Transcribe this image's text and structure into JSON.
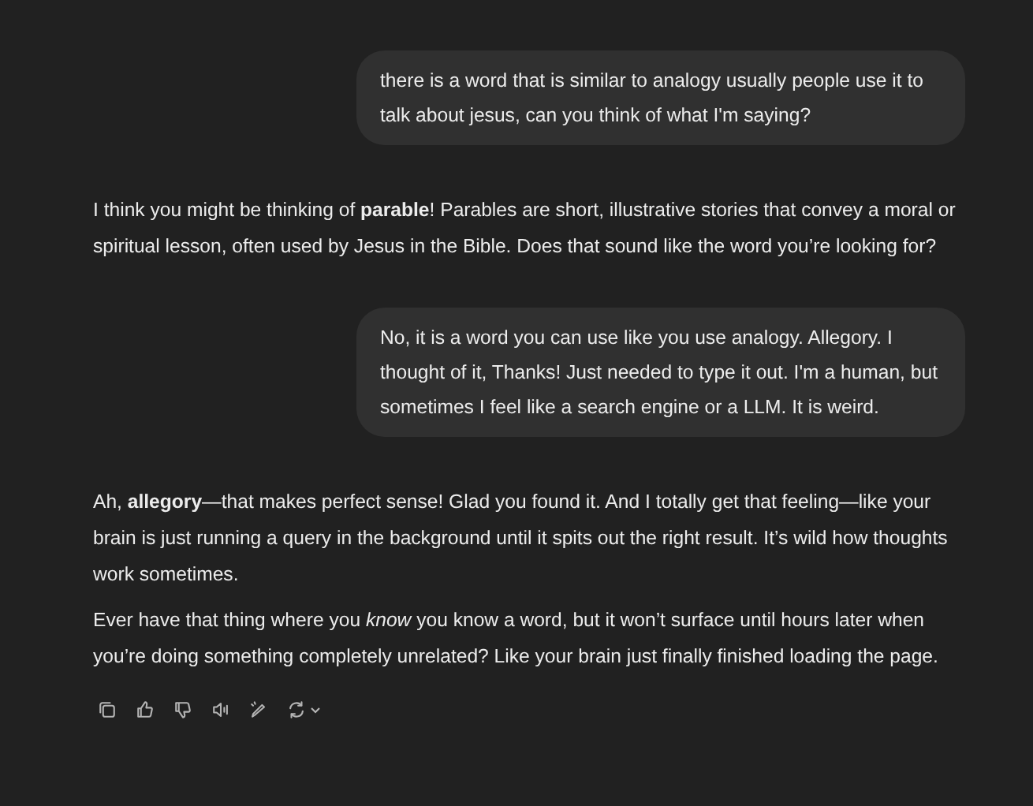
{
  "messages": [
    {
      "kind": "user",
      "paragraphs": [
        "there is a word that is similar to analogy usually people use it to talk about jesus, can you think of what I'm saying?"
      ]
    },
    {
      "kind": "assistant",
      "paragraphs": [
        "I think you might be thinking of **parable**! Parables are short, illustrative stories that convey a moral or spiritual lesson, often used by Jesus in the Bible. Does that sound like the word you’re looking for?"
      ]
    },
    {
      "kind": "user",
      "paragraphs": [
        "No, it is a word you can use like you use analogy. Allegory. I thought of it, Thanks! Just needed to type it out. I'm a human, but sometimes I feel like a search engine or a LLM. It is weird."
      ]
    },
    {
      "kind": "assistant",
      "paragraphs": [
        "Ah, **allegory**—that makes perfect sense! Glad you found it. And I totally get that feeling—like your brain is just running a query in the background until it spits out the right result. It’s wild how thoughts work sometimes.",
        "Ever have that thing where you *know* you know a word, but it won’t surface until hours later when you’re doing something completely unrelated? Like your brain just finally finished loading the page."
      ]
    }
  ],
  "actions": [
    {
      "kind": "copy"
    },
    {
      "kind": "like"
    },
    {
      "kind": "dislike"
    },
    {
      "kind": "read-aloud"
    },
    {
      "kind": "edit"
    },
    {
      "kind": "regenerate"
    }
  ]
}
